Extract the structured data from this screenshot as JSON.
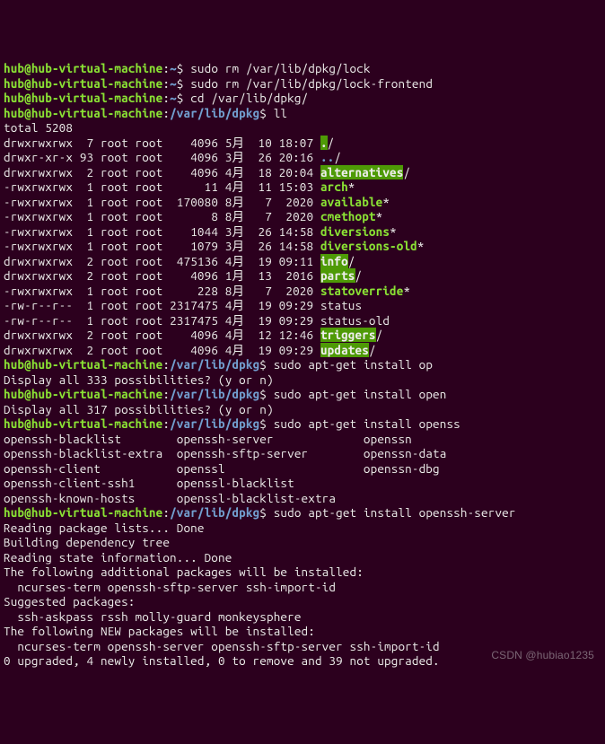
{
  "prompt": {
    "user_host": "hub@hub-virtual-machine",
    "sep": ":",
    "home": "~",
    "path": "/var/lib/dpkg",
    "end": "$"
  },
  "cmds": {
    "c1": "sudo rm /var/lib/dpkg/lock",
    "c2": "sudo rm /var/lib/dpkg/lock-frontend",
    "c3": "cd /var/lib/dpkg/",
    "c4": "ll",
    "c5": "sudo apt-get install op",
    "c6": "sudo apt-get install open",
    "c7": "sudo apt-get install openss",
    "c8": "sudo apt-get install openssh-server"
  },
  "ll": {
    "total": "total 5208",
    "rows": [
      {
        "perm": "drwxrwxrwx",
        "ln": "7",
        "own": "root",
        "grp": "root",
        "size": "4096",
        "mon": "5月",
        "day": "10",
        "time": "18:07",
        "name": ".",
        "kind": "hidir",
        "suf": "/"
      },
      {
        "perm": "drwxr-xr-x",
        "ln": "93",
        "own": "root",
        "grp": "root",
        "size": "4096",
        "mon": "3月",
        "day": "26",
        "time": "20:16",
        "name": "..",
        "kind": "bl",
        "suf": "/"
      },
      {
        "perm": "drwxrwxrwx",
        "ln": "2",
        "own": "root",
        "grp": "root",
        "size": "4096",
        "mon": "4月",
        "day": "18",
        "time": "20:04",
        "name": "alternatives",
        "kind": "hidir",
        "suf": "/"
      },
      {
        "perm": "-rwxrwxrwx",
        "ln": "1",
        "own": "root",
        "grp": "root",
        "size": "11",
        "mon": "4月",
        "day": "11",
        "time": "15:03",
        "name": "arch",
        "kind": "exec",
        "suf": "*"
      },
      {
        "perm": "-rwxrwxrwx",
        "ln": "1",
        "own": "root",
        "grp": "root",
        "size": "170080",
        "mon": "8月",
        "day": "7",
        "time": "2020",
        "name": "available",
        "kind": "exec",
        "suf": "*"
      },
      {
        "perm": "-rwxrwxrwx",
        "ln": "1",
        "own": "root",
        "grp": "root",
        "size": "8",
        "mon": "8月",
        "day": "7",
        "time": "2020",
        "name": "cmethopt",
        "kind": "exec",
        "suf": "*"
      },
      {
        "perm": "-rwxrwxrwx",
        "ln": "1",
        "own": "root",
        "grp": "root",
        "size": "1044",
        "mon": "3月",
        "day": "26",
        "time": "14:58",
        "name": "diversions",
        "kind": "exec",
        "suf": "*"
      },
      {
        "perm": "-rwxrwxrwx",
        "ln": "1",
        "own": "root",
        "grp": "root",
        "size": "1079",
        "mon": "3月",
        "day": "26",
        "time": "14:58",
        "name": "diversions-old",
        "kind": "exec",
        "suf": "*"
      },
      {
        "perm": "drwxrwxrwx",
        "ln": "2",
        "own": "root",
        "grp": "root",
        "size": "475136",
        "mon": "4月",
        "day": "19",
        "time": "09:11",
        "name": "info",
        "kind": "hidir",
        "suf": "/"
      },
      {
        "perm": "drwxrwxrwx",
        "ln": "2",
        "own": "root",
        "grp": "root",
        "size": "4096",
        "mon": "1月",
        "day": "13",
        "time": "2016",
        "name": "parts",
        "kind": "hidir",
        "suf": "/"
      },
      {
        "perm": "-rwxrwxrwx",
        "ln": "1",
        "own": "root",
        "grp": "root",
        "size": "228",
        "mon": "8月",
        "day": "7",
        "time": "2020",
        "name": "statoverride",
        "kind": "exec",
        "suf": "*"
      },
      {
        "perm": "-rw-r--r--",
        "ln": "1",
        "own": "root",
        "grp": "root",
        "size": "2317475",
        "mon": "4月",
        "day": "19",
        "time": "09:29",
        "name": "status",
        "kind": "plain",
        "suf": ""
      },
      {
        "perm": "-rw-r--r--",
        "ln": "1",
        "own": "root",
        "grp": "root",
        "size": "2317475",
        "mon": "4月",
        "day": "19",
        "time": "09:29",
        "name": "status-old",
        "kind": "plain",
        "suf": ""
      },
      {
        "perm": "drwxrwxrwx",
        "ln": "2",
        "own": "root",
        "grp": "root",
        "size": "4096",
        "mon": "4月",
        "day": "12",
        "time": "12:46",
        "name": "triggers",
        "kind": "hidir",
        "suf": "/"
      },
      {
        "perm": "drwxrwxrwx",
        "ln": "2",
        "own": "root",
        "grp": "root",
        "size": "4096",
        "mon": "4月",
        "day": "19",
        "time": "09:29",
        "name": "updates",
        "kind": "hidir",
        "suf": "/"
      }
    ]
  },
  "tab1": "Display all 333 possibilities? (y or n)",
  "tab2": "Display all 317 possibilities? (y or n)",
  "completions": [
    [
      "openssh-blacklist",
      "openssh-server",
      "openssn"
    ],
    [
      "openssh-blacklist-extra",
      "openssh-sftp-server",
      "openssn-data"
    ],
    [
      "openssh-client",
      "openssl",
      "openssn-dbg"
    ],
    [
      "openssh-client-ssh1",
      "openssl-blacklist",
      ""
    ],
    [
      "openssh-known-hosts",
      "openssl-blacklist-extra",
      ""
    ]
  ],
  "apt": {
    "l1": "Reading package lists... Done",
    "l2": "Building dependency tree",
    "l3": "Reading state information... Done",
    "l4": "The following additional packages will be installed:",
    "l5": "  ncurses-term openssh-sftp-server ssh-import-id",
    "l6": "Suggested packages:",
    "l7": "  ssh-askpass rssh molly-guard monkeysphere",
    "l8": "The following NEW packages will be installed:",
    "l9": "  ncurses-term openssh-server openssh-sftp-server ssh-import-id",
    "l10": "0 upgraded, 4 newly installed, 0 to remove and 39 not upgraded."
  },
  "watermark": "CSDN @hubiao1235"
}
